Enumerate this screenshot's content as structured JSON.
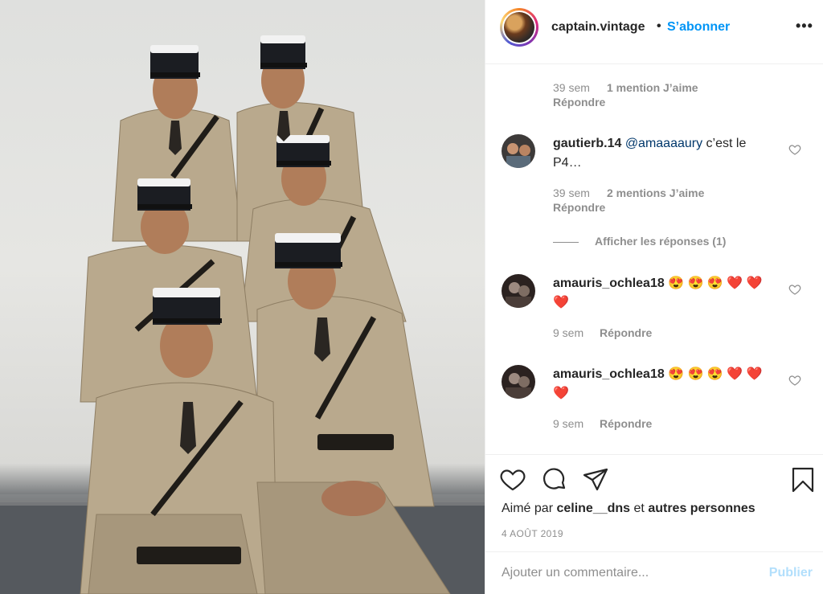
{
  "post": {
    "header": {
      "username": "captain.vintage",
      "separator": "•",
      "follow_label": "S’abonner",
      "more_icon": "more-options-icon",
      "more_label": "•••"
    },
    "comments": [
      {
        "time": "39 sem",
        "likes": "1 mention J’aime",
        "reply_label": "Répondre"
      },
      {
        "username": "gautierb.14",
        "mention": "@amaaaaury",
        "text_line1": " c’est le",
        "text_line2": "P4…",
        "time": "39 sem",
        "likes": "2 mentions J’aime",
        "reply_label": "Répondre",
        "view_replies": "Afficher les réponses (1)"
      },
      {
        "username": "amauris_ochlea18",
        "text": " 😍 😍 😍 ❤️ ❤️",
        "text_line2": "❤️",
        "time": "9 sem",
        "reply_label": "Répondre"
      },
      {
        "username": "amauris_ochlea18",
        "text": " 😍 😍 😍 ❤️ ❤️",
        "text_line2": "❤️",
        "time": "9 sem",
        "reply_label": "Répondre"
      }
    ],
    "actions": {
      "like_icon": "heart-icon",
      "comment_icon": "comment-icon",
      "share_icon": "share-icon",
      "save_icon": "bookmark-icon"
    },
    "likes": {
      "prefix": "Aimé par ",
      "user": "celine__dns",
      "middle": " et ",
      "others": "autres personnes"
    },
    "date": "4 AOÛT 2019",
    "add_comment": {
      "placeholder": "Ajouter un commentaire...",
      "publish_label": "Publier"
    },
    "colors": {
      "accent": "#0095f6",
      "publish_disabled": "#b2dffc",
      "muted": "#8e8e8e",
      "text": "#262626"
    }
  }
}
